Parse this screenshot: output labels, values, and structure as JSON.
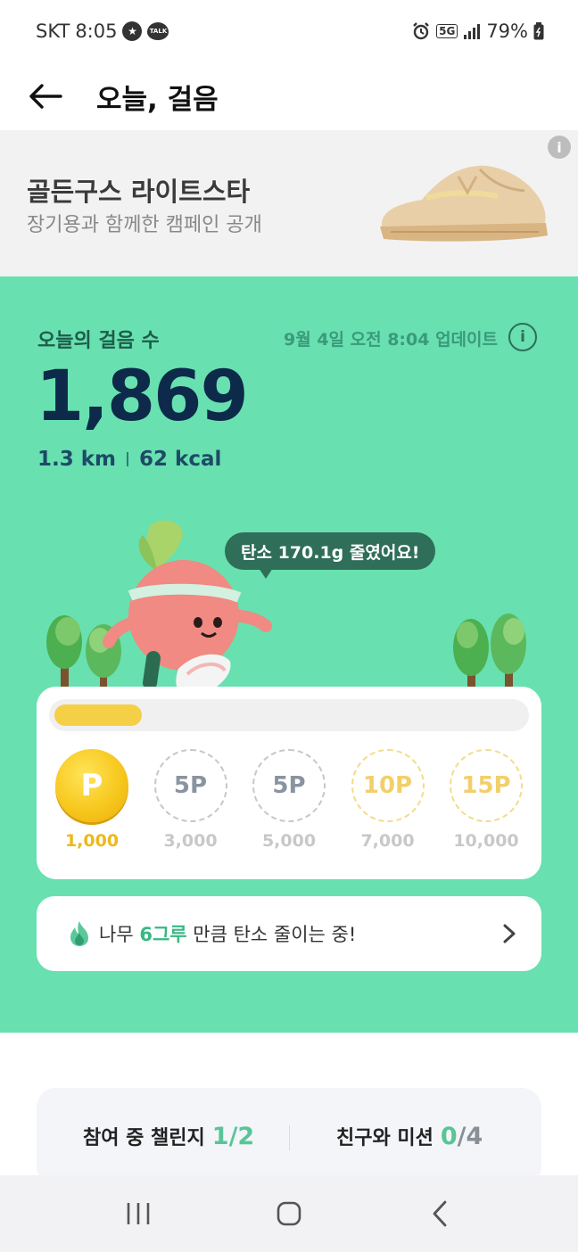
{
  "status_bar": {
    "carrier": "SKT",
    "time": "8:05",
    "talk_badge": "TALK",
    "network": "5G",
    "battery": "79%"
  },
  "header": {
    "title": "오늘, 걸음"
  },
  "ad": {
    "title": "골든구스 라이트스타",
    "subtitle": "장기용과 함께한 캠페인 공개",
    "info_glyph": "i"
  },
  "steps": {
    "label": "오늘의 걸음 수",
    "updated": "9월 4일 오전 8:04 업데이트",
    "count": "1,869",
    "distance": "1.3 km",
    "kcal": "62 kcal",
    "info_glyph": "i"
  },
  "bubble": {
    "text": "탄소 170.1g 줄였어요!"
  },
  "reward": {
    "progress_fraction": 0.187,
    "milestones": [
      {
        "coin": "P",
        "steps": "1,000",
        "state": "active"
      },
      {
        "coin": "5P",
        "steps": "3,000",
        "state": "gray"
      },
      {
        "coin": "5P",
        "steps": "5,000",
        "state": "gray"
      },
      {
        "coin": "10P",
        "steps": "7,000",
        "state": "gold"
      },
      {
        "coin": "15P",
        "steps": "10,000",
        "state": "gold"
      }
    ]
  },
  "tree_banner": {
    "prefix": "나무 ",
    "count": "6그루",
    "suffix": " 만큼 탄소 줄이는 중!"
  },
  "challenge": {
    "left_label": "참여 중 챌린지",
    "left_done": "1",
    "left_total": "/2",
    "right_label": "친구와 미션",
    "right_done": "0",
    "right_total": "/4"
  },
  "icons": {
    "back": "arrow-left-icon",
    "info": "info-icon",
    "fire": "fire-icon",
    "chevron": "chevron-right-icon",
    "recents": "recents-icon",
    "home": "home-icon",
    "nav_back": "nav-back-icon"
  },
  "colors": {
    "green_bg": "#68e0b0",
    "accent_green": "#38b882",
    "coin_gold": "#f7c81e",
    "navy_text": "#0d2a4a"
  }
}
